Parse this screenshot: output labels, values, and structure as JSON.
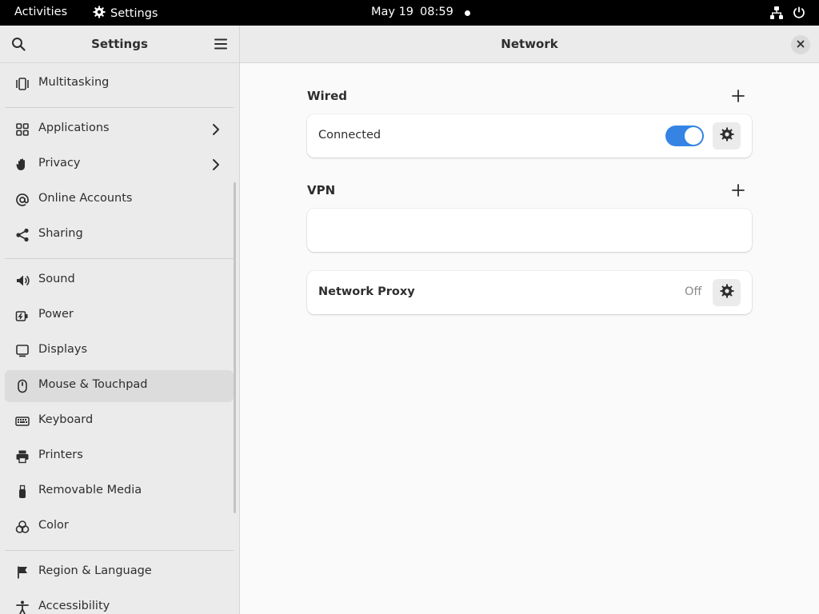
{
  "topbar": {
    "activities": "Activities",
    "app_name": "Settings",
    "date": "May 19",
    "time": "08:59"
  },
  "sidebar": {
    "title": "Settings",
    "items": [
      {
        "label": "Multitasking",
        "icon": "multitasking-icon"
      },
      {
        "label": "Applications",
        "icon": "applications-icon",
        "has_submenu": true
      },
      {
        "label": "Privacy",
        "icon": "hand-icon",
        "has_submenu": true
      },
      {
        "label": "Online Accounts",
        "icon": "at-sign-icon"
      },
      {
        "label": "Sharing",
        "icon": "share-icon"
      },
      {
        "label": "Sound",
        "icon": "speaker-icon"
      },
      {
        "label": "Power",
        "icon": "battery-icon"
      },
      {
        "label": "Displays",
        "icon": "monitor-icon"
      },
      {
        "label": "Mouse & Touchpad",
        "icon": "mouse-icon",
        "active": true
      },
      {
        "label": "Keyboard",
        "icon": "keyboard-icon"
      },
      {
        "label": "Printers",
        "icon": "printer-icon"
      },
      {
        "label": "Removable Media",
        "icon": "usb-icon"
      },
      {
        "label": "Color",
        "icon": "color-icon"
      },
      {
        "label": "Region & Language",
        "icon": "flag-icon"
      },
      {
        "label": "Accessibility",
        "icon": "accessibility-icon"
      }
    ]
  },
  "main": {
    "title": "Network",
    "wired": {
      "title": "Wired",
      "status": "Connected",
      "enabled": true
    },
    "vpn": {
      "title": "VPN"
    },
    "proxy": {
      "label": "Network Proxy",
      "status": "Off"
    }
  },
  "colors": {
    "accent": "#3584e4",
    "topbar": "#000000",
    "sidebar_bg": "#ebebeb",
    "main_bg": "#fafafa"
  }
}
